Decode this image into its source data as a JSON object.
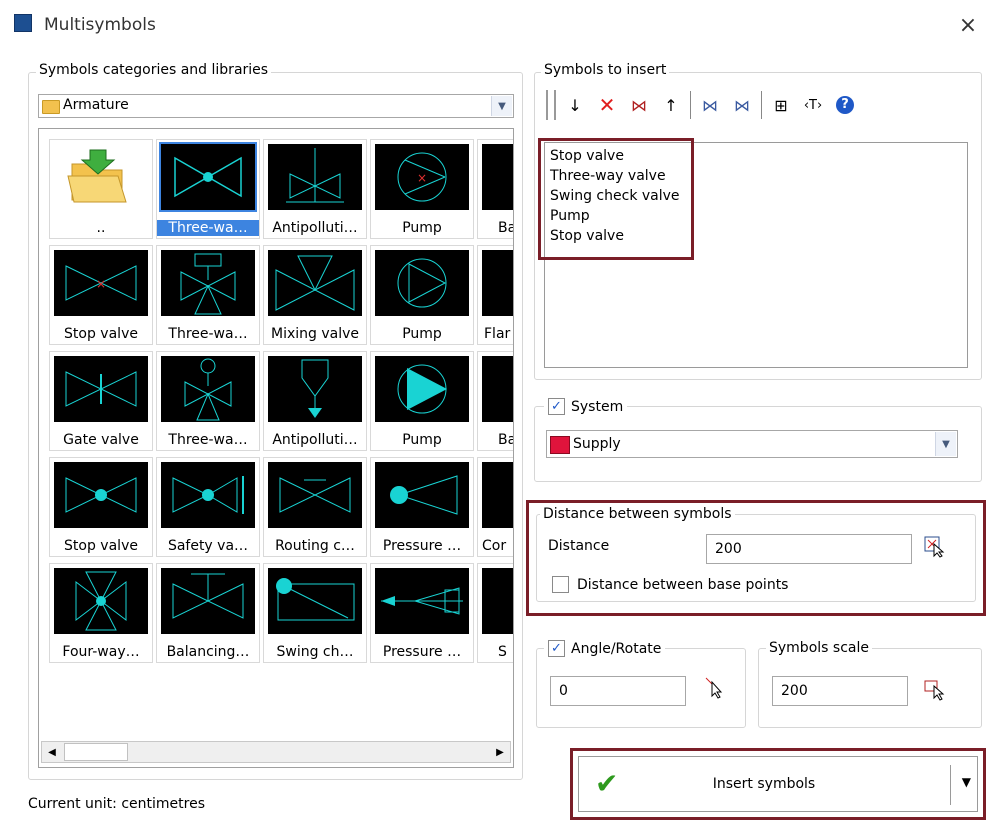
{
  "window": {
    "title": "Multisymbols",
    "close_glyph": "×"
  },
  "categories": {
    "legend": "Symbols categories and libraries",
    "selected": "Armature",
    "tiles": [
      [
        "..",
        "Three-wa…",
        "Antipolluti…",
        "Pump",
        "Ba"
      ],
      [
        "Stop valve",
        "Three-wa…",
        "Mixing valve",
        "Pump",
        "Flar"
      ],
      [
        "Gate valve",
        "Three-wa…",
        "Antipolluti…",
        "Pump",
        "Ba"
      ],
      [
        "Stop valve",
        "Safety va…",
        "Routing c…",
        "Pressure …",
        "Cor"
      ],
      [
        "Four-way…",
        "Balancing…",
        "Swing ch…",
        "Pressure …",
        "S"
      ]
    ]
  },
  "insert_panel": {
    "legend": "Symbols to insert",
    "toolbar_icons": [
      "arrow-down-icon",
      "delete-icon",
      "clear-icon",
      "arrow-up-icon",
      "pick-icon",
      "replace-icon",
      "find-icon",
      "text-icon",
      "help-icon"
    ],
    "items": [
      "Stop valve",
      "Three-way valve",
      "Swing check valve",
      "Pump",
      "Stop valve"
    ]
  },
  "system": {
    "label": "System",
    "checked": true,
    "value": "Supply",
    "color": "#e0143c"
  },
  "distance": {
    "legend": "Distance between symbols",
    "label": "Distance",
    "value": "200",
    "base_points_label": "Distance between base points",
    "base_points_checked": false
  },
  "angle": {
    "label": "Angle/Rotate",
    "checked": true,
    "value": "0"
  },
  "scale": {
    "legend": "Symbols scale",
    "value": "200"
  },
  "insert_button": {
    "label": "Insert symbols"
  },
  "status": {
    "unit_text": "Current unit: centimetres"
  },
  "colors": {
    "accent": "#3d84e0",
    "highlight_box": "#7a1e28",
    "symbol_line": "#19d3d3",
    "symbol_bg": "#000000"
  }
}
